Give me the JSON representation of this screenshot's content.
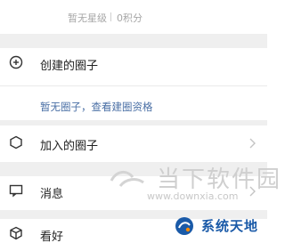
{
  "profile": {
    "level_text": "暂无星级",
    "points_text": "0积分"
  },
  "menu": {
    "create_circle": {
      "label": "创建的圈子",
      "hint": "暂无圈子，查看建圈资格"
    },
    "joined_circle": {
      "label": "加入的圈子"
    },
    "messages": {
      "label": "消息"
    },
    "favorites": {
      "label": "看好"
    }
  },
  "watermark": {
    "title": "当下软件园",
    "url": "www.downxia.com",
    "badge_text": "系统天地"
  },
  "colors": {
    "accent_link": "#4a6fa5",
    "separator": "#efefef",
    "text_secondary": "#a6a6a6"
  }
}
